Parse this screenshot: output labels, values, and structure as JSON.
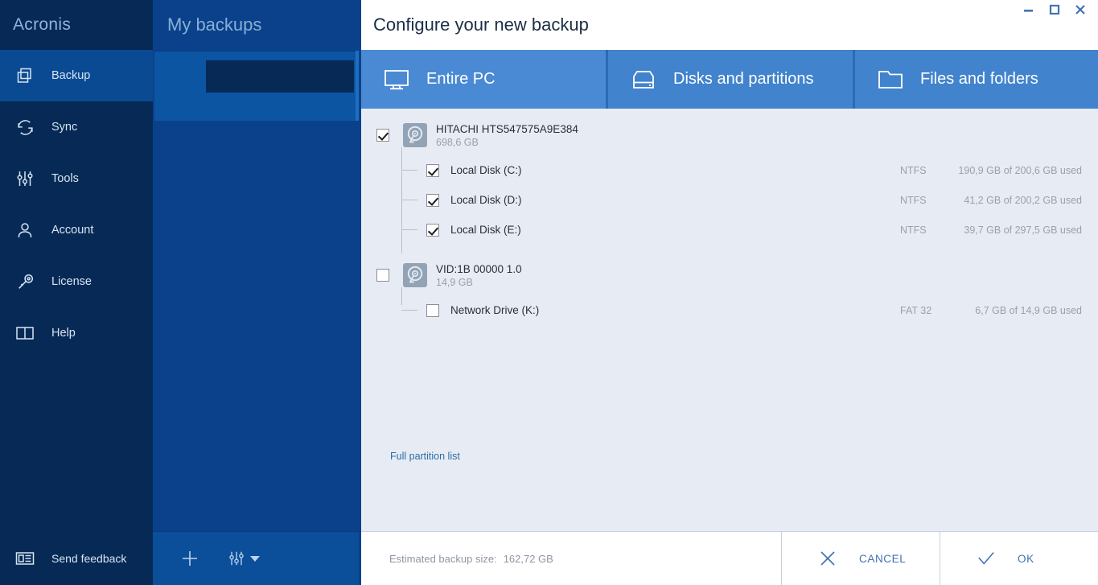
{
  "brand": {
    "name": "Acronis"
  },
  "sidebar": {
    "items": [
      {
        "label": "Backup",
        "icon": "backup-icon",
        "active": true
      },
      {
        "label": "Sync",
        "icon": "sync-icon",
        "active": false
      },
      {
        "label": "Tools",
        "icon": "tools-icon",
        "active": false
      },
      {
        "label": "Account",
        "icon": "account-icon",
        "active": false
      },
      {
        "label": "License",
        "icon": "license-key-icon",
        "active": false
      },
      {
        "label": "Help",
        "icon": "help-book-icon",
        "active": false
      }
    ],
    "feedback": {
      "label": "Send feedback",
      "icon": "feedback-card-icon"
    }
  },
  "backup_list": {
    "title": "My backups",
    "toolbar": {
      "add_label": "+",
      "add_icon": "plus-icon",
      "options_icon": "sliders-icon",
      "caret_icon": "caret-down-icon"
    }
  },
  "dialog": {
    "title": "Configure your new backup",
    "window_controls": {
      "minimize": "minimize-icon",
      "maximize": "maximize-icon",
      "close": "close-icon"
    },
    "tabs": [
      {
        "label": "Entire PC",
        "icon": "monitor-icon",
        "selected": true
      },
      {
        "label": "Disks and partitions",
        "icon": "disk-icon",
        "selected": false
      },
      {
        "label": "Files and folders",
        "icon": "folder-icon",
        "selected": false
      }
    ],
    "disks": [
      {
        "name": "HITACHI HTS547575A9E384",
        "size": "698,6 GB",
        "checked": true,
        "icon": "hard-disk-icon",
        "partitions": [
          {
            "name": "Local Disk (C:)",
            "fs": "NTFS",
            "used": "190,9 GB of 200,6 GB used",
            "checked": true
          },
          {
            "name": "Local Disk (D:)",
            "fs": "NTFS",
            "used": "41,2 GB of 200,2 GB used",
            "checked": true
          },
          {
            "name": "Local Disk (E:)",
            "fs": "NTFS",
            "used": "39,7 GB of 297,5 GB used",
            "checked": true
          }
        ]
      },
      {
        "name": "VID:1B 00000 1.0",
        "size": "14,9 GB",
        "checked": false,
        "icon": "hard-disk-icon",
        "partitions": [
          {
            "name": "Network Drive (K:)",
            "fs": "FAT 32",
            "used": "6,7 GB of 14,9 GB used",
            "checked": false
          }
        ]
      }
    ],
    "full_partition_link": "Full partition list",
    "footer": {
      "estimate_label": "Estimated backup size:",
      "estimate_value": "162,72 GB",
      "cancel_label": "CANCEL",
      "cancel_icon": "x-icon",
      "ok_label": "OK",
      "ok_icon": "check-icon"
    }
  },
  "colors": {
    "sidebar_bg": "#062a55",
    "sidebar_active": "#0a4a92",
    "list_bg": "#0a418a",
    "card_bg": "#0b55a3",
    "tab_selected": "#4a8ad4",
    "tab_normal": "#4183cd",
    "content_bg": "#e7ebf4",
    "accent_link": "#2e6ea8",
    "action_blue": "#4372b4"
  }
}
